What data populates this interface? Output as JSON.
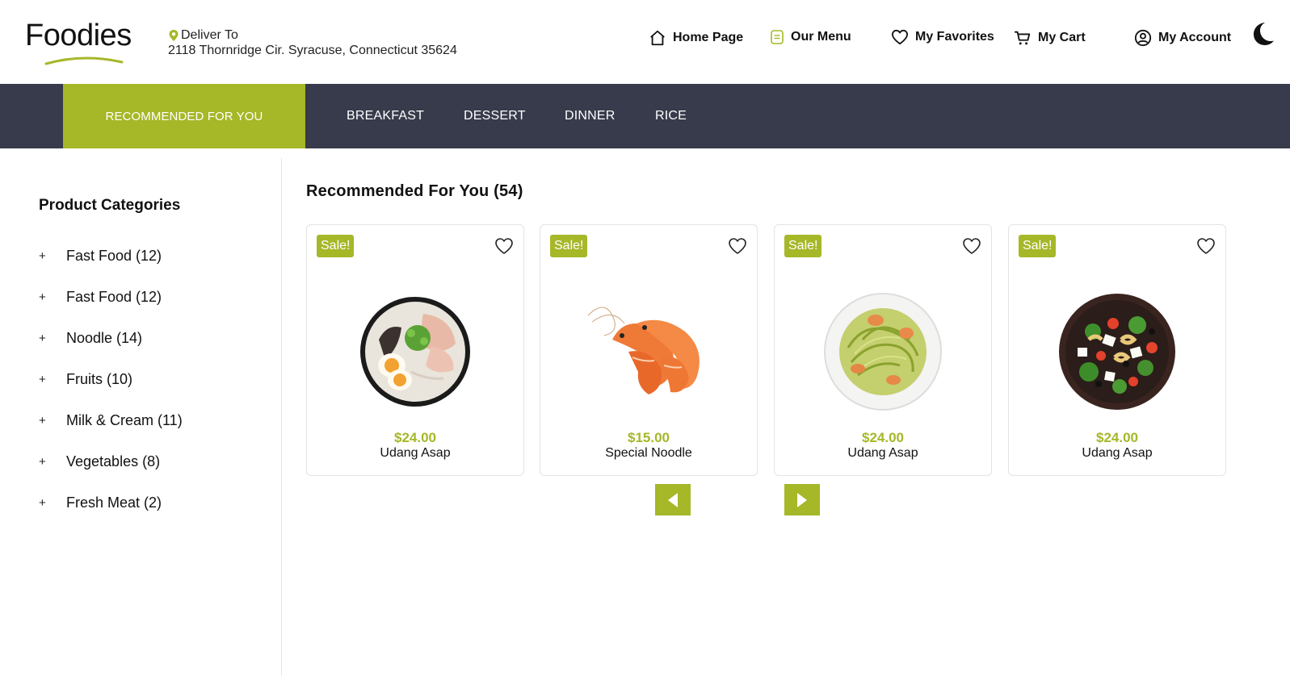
{
  "brand": {
    "name": "Foodies",
    "accent": "#a6b728",
    "dark": "#373b4b"
  },
  "delivery": {
    "label": "Deliver To",
    "address": "2118 Thornridge Cir. Syracuse, Connecticut 35624"
  },
  "nav": {
    "home": "Home Page",
    "menu": "Our Menu",
    "favorites": "My Favorites",
    "cart": "My Cart",
    "account": "My Account"
  },
  "categories_bar": {
    "active": "RECOMMENDED FOR YOU",
    "items": [
      "BREAKFAST",
      "DESSERT",
      "DINNER",
      "RICE"
    ]
  },
  "sidebar": {
    "title": "Product Categories",
    "items": [
      {
        "label": "Fast Food (12)"
      },
      {
        "label": "Fast Food (12)"
      },
      {
        "label": "Noodle (14)"
      },
      {
        "label": "Fruits (10)"
      },
      {
        "label": "Milk & Cream (11)"
      },
      {
        "label": "Vegetables (8)"
      },
      {
        "label": "Fresh Meat (2)"
      }
    ]
  },
  "main": {
    "title": "Recommended For You (54)",
    "products": [
      {
        "badge": "Sale!",
        "price": "$24.00",
        "name": "Udang Asap",
        "image": "ramen-bowl"
      },
      {
        "badge": "Sale!",
        "price": "$15.00",
        "name": "Special Noodle",
        "image": "shrimp"
      },
      {
        "badge": "Sale!",
        "price": "$24.00",
        "name": "Udang Asap",
        "image": "pesto-pasta"
      },
      {
        "badge": "Sale!",
        "price": "$24.00",
        "name": "Udang Asap",
        "image": "pasta-salad"
      }
    ]
  },
  "icons": {
    "home": "home-icon",
    "menu": "menu-icon",
    "favorites": "heart-icon",
    "cart": "cart-icon",
    "account": "user-circle-icon",
    "theme": "moon-icon",
    "prev": "arrow-left-icon",
    "next": "arrow-right-icon"
  }
}
